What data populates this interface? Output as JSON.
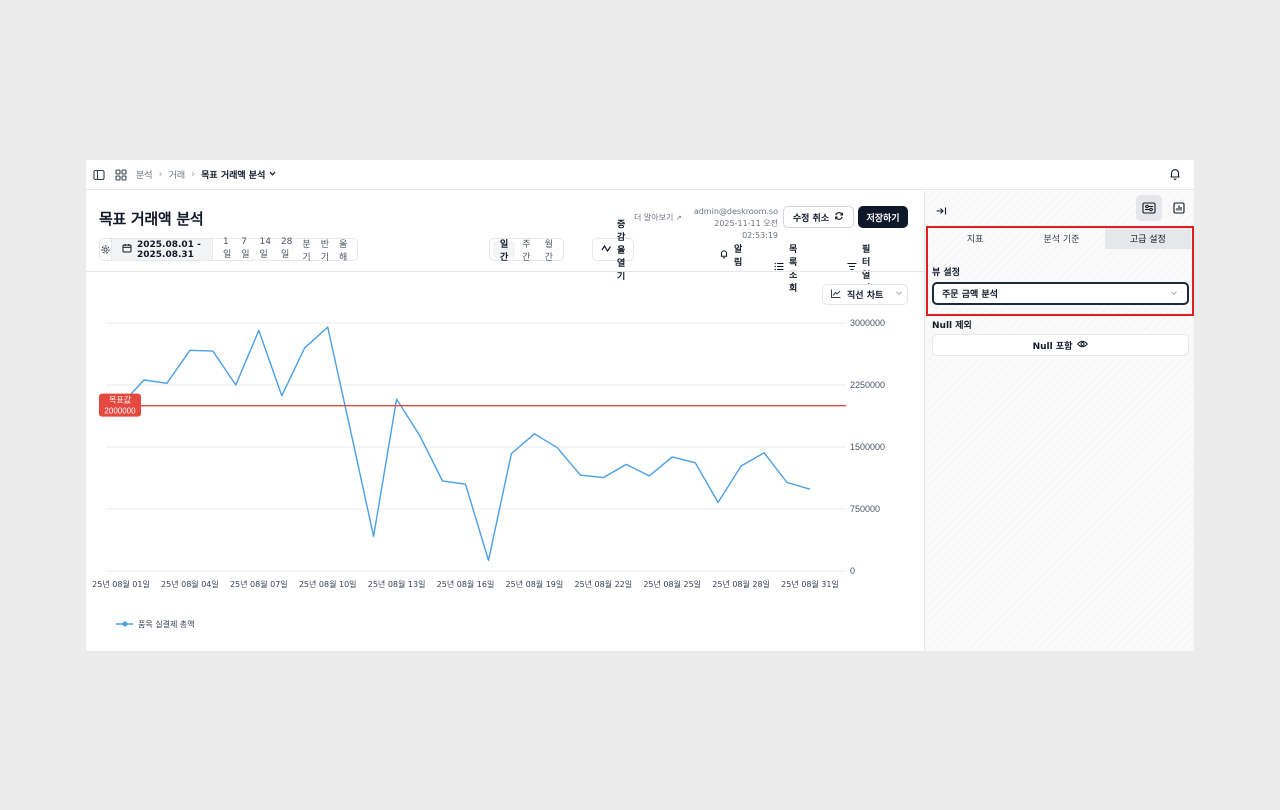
{
  "breadcrumb": {
    "items": [
      "분석",
      "거래",
      "목표 거래액 분석"
    ]
  },
  "header": {
    "title": "목표 거래액 분석",
    "learn_more": "더 알아보기",
    "author_email": "admin@deskroom.so",
    "modified_at": "2025-11-11 오전 02:53:19",
    "cancel_label": "수정 취소",
    "save_label": "저장하기"
  },
  "toolbar": {
    "date_range": "2025.08.01 - 2025.08.31",
    "ranges": [
      "1일",
      "7일",
      "14일",
      "28일",
      "분기",
      "반기",
      "올해"
    ],
    "periods": [
      "일간",
      "주간",
      "월간"
    ],
    "active_period": "일간",
    "growth_label": "증감율 열기",
    "alert_label": "알림",
    "list_label": "목록 조회",
    "filter_label": "필터 열기"
  },
  "chart_type_label": "직선 차트",
  "colors": {
    "line": "#4a9fe6",
    "target": "#e5483f",
    "save_button": "#0f172a",
    "highlight": "#e11d1d"
  },
  "chart_data": {
    "type": "line",
    "x": [
      "25년 08월 01일",
      "25년 08월 02일",
      "25년 08월 03일",
      "25년 08월 04일",
      "25년 08월 05일",
      "25년 08월 06일",
      "25년 08월 07일",
      "25년 08월 08일",
      "25년 08월 09일",
      "25년 08월 10일",
      "25년 08월 11일",
      "25년 08월 12일",
      "25년 08월 13일",
      "25년 08월 14일",
      "25년 08월 15일",
      "25년 08월 16일",
      "25년 08월 17일",
      "25년 08월 18일",
      "25년 08월 19일",
      "25년 08월 20일",
      "25년 08월 21일",
      "25년 08월 22일",
      "25년 08월 23일",
      "25년 08월 24일",
      "25년 08월 25일",
      "25년 08월 26일",
      "25년 08월 27일",
      "25년 08월 28일",
      "25년 08월 29일",
      "25년 08월 30일",
      "25년 08월 31일"
    ],
    "xtick_labels": [
      "25년 08월 01일",
      "25년 08월 04일",
      "25년 08월 07일",
      "25년 08월 10일",
      "25년 08월 13일",
      "25년 08월 16일",
      "25년 08월 19일",
      "25년 08월 22일",
      "25년 08월 25일",
      "25년 08월 28일",
      "25년 08월 31일"
    ],
    "series": [
      {
        "name": "품목 실결제 총액",
        "values": [
          2010000,
          2310000,
          2270000,
          2670000,
          2660000,
          2250000,
          2910000,
          2120000,
          2700000,
          2950000,
          1690000,
          420000,
          2080000,
          1640000,
          1090000,
          1050000,
          130000,
          1420000,
          1660000,
          1490000,
          1160000,
          1130000,
          1290000,
          1150000,
          1380000,
          1310000,
          830000,
          1270000,
          1430000,
          1070000,
          990000
        ]
      }
    ],
    "target": {
      "label": "목표값",
      "value": 2000000
    },
    "ylim": [
      0,
      3000000
    ],
    "yticks": [
      0,
      750000,
      1500000,
      2250000,
      3000000
    ],
    "grid": true,
    "legend_position": "bottom-left"
  },
  "panel": {
    "tabs": [
      "지표",
      "분석 기준",
      "고급 설정"
    ],
    "active_tab": "고급 설정",
    "view_setting_label": "뷰 설정",
    "view_select_value": "주문 금액 분석",
    "null_label": "Null 제외",
    "null_button_label": "Null 포함"
  }
}
